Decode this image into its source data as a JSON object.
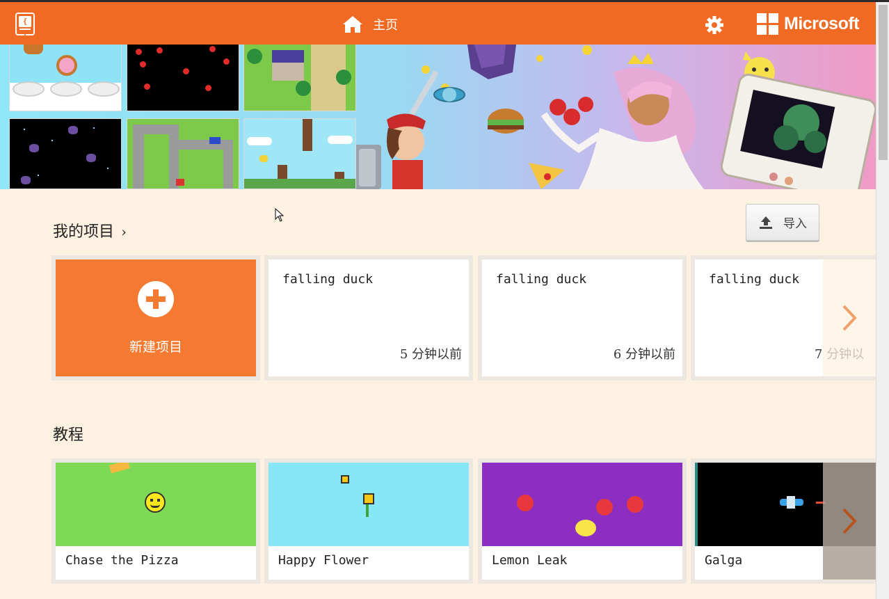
{
  "header": {
    "home_label": "主页",
    "brand_label": "Microsoft",
    "logo_text": "{ }"
  },
  "projects": {
    "title": "我的项目",
    "import_label": "导入",
    "new_label": "新建项目",
    "items": [
      {
        "title": "falling duck",
        "time": "5 分钟以前"
      },
      {
        "title": "falling duck",
        "time": "6 分钟以前"
      },
      {
        "title": "falling duck",
        "time": "7 分钟以"
      }
    ]
  },
  "tutorials": {
    "title": "教程",
    "items": [
      {
        "title": "Chase the Pizza",
        "thumb_color": "#7ed957"
      },
      {
        "title": "Happy Flower",
        "thumb_color": "#87e7f8"
      },
      {
        "title": "Lemon Leak",
        "thumb_color": "#8d2ec3"
      },
      {
        "title": "Galga",
        "thumb_color": "#000000"
      }
    ]
  },
  "colors": {
    "accent": "#f06a23",
    "page_bg": "#fdf1e1",
    "new_project": "#f57a31"
  },
  "icons": [
    "logo-icon",
    "home-icon",
    "gear-icon",
    "microsoft-logo-icon",
    "upload-icon",
    "plus-icon",
    "chevron-right-icon"
  ]
}
